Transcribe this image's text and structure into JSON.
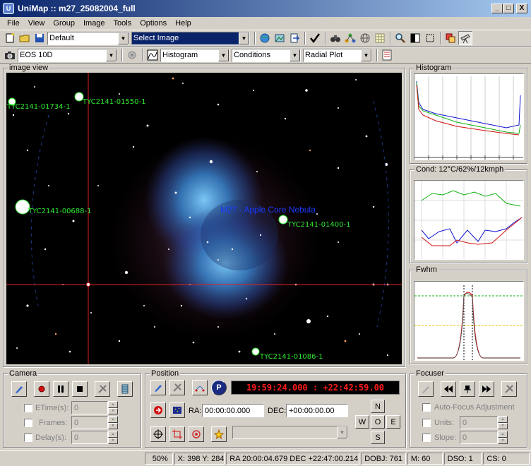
{
  "window": {
    "title": "UniMap :: m27_25082004_full",
    "app_icon": "U",
    "minimize": "_",
    "maximize": "□",
    "close": "X"
  },
  "menu": [
    "File",
    "View",
    "Group",
    "Image",
    "Tools",
    "Options",
    "Help"
  ],
  "toolbar1": {
    "profile": "Default",
    "image_select": "Select Image"
  },
  "toolbar2": {
    "camera": "EOS 10D",
    "graph1": "Histogram",
    "graph2": "Conditions",
    "graph3": "Radial Plot"
  },
  "image_view": {
    "label": "image view",
    "object_label": "M27 - Apple Core Nebula",
    "stars": [
      {
        "name": "TYC2141-01734-1"
      },
      {
        "name": "TYC2141-01550-1"
      },
      {
        "name": "TYC2141-00688-1"
      },
      {
        "name": "TYC2141-01400-1"
      },
      {
        "name": "TYC2141-01086-1"
      }
    ]
  },
  "histogram": {
    "label": "Histogram"
  },
  "conditions": {
    "label": "Cond: 12°C/62%/12kmph"
  },
  "fwhm": {
    "label": "Fwhm"
  },
  "camera_panel": {
    "label": "Camera",
    "etime_label": "ETime(s):",
    "etime_value": "0",
    "frames_label": "Frames:",
    "frames_value": "0",
    "delay_label": "Delay(s):",
    "delay_value": "0"
  },
  "position_panel": {
    "label": "Position",
    "clock": "19:59:24.000 : +22:42:59.00",
    "ra_label": "RA:",
    "ra_value": "00:00:00.000",
    "dec_label": "DEC:",
    "dec_value": "+00:00:00.00",
    "north": "N",
    "south": "S",
    "west": "W",
    "east": "E",
    "center": "O",
    "p_button": "P"
  },
  "focuser_panel": {
    "label": "Focuser",
    "autofocus_label": "Auto-Focus Adjustment",
    "units_label": "Units:",
    "units_value": "0",
    "slope_label": "Slope:",
    "slope_value": "0"
  },
  "status": {
    "zoom": "50%",
    "xy": "X: 398 Y: 284",
    "radec": "RA  20:00:04.679 DEC +22:47:00.214",
    "dobj": "DOBJ: 761",
    "m": "M:  60",
    "dso": "DSO:  1",
    "cs": "CS:  0"
  },
  "colors": {
    "title_start": "#0a246a",
    "title_end": "#a6caf0",
    "star_label": "#2ee82e",
    "object_label": "#1a3aff",
    "clock_text": "#ff1a1a",
    "crosshair": "#e02020"
  }
}
